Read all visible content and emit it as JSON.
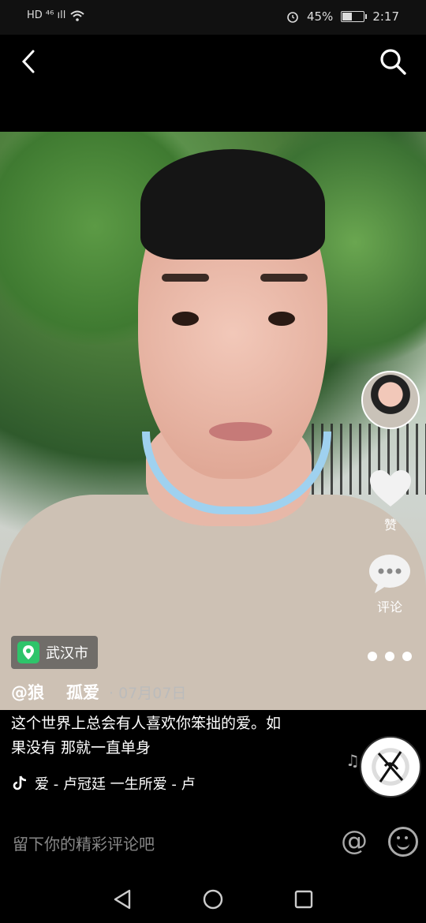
{
  "status_bar": {
    "left_indicators": "HD ⁴⁶ ıll",
    "battery_percent": "45%",
    "time": "2:17",
    "battery_level": 0.45
  },
  "header": {
    "back_icon": "back-arrow-icon",
    "search_icon": "search-icon"
  },
  "right_actions": {
    "like_label": "赞",
    "comment_label": "评论"
  },
  "post": {
    "location": "武汉市",
    "author": "@狼",
    "author_suffix": "孤爱",
    "date": "· 07月07日",
    "caption": "这个世界上总会有人喜欢你笨拙的爱。如果没有  那就一直单身",
    "music": "爱 - 卢冠廷    一生所爱 - 卢"
  },
  "comment_bar": {
    "placeholder": "留下你的精彩评论吧"
  },
  "colors": {
    "background": "#000000",
    "location_pin": "#2ec46a",
    "mask": "#9fd1ef"
  }
}
